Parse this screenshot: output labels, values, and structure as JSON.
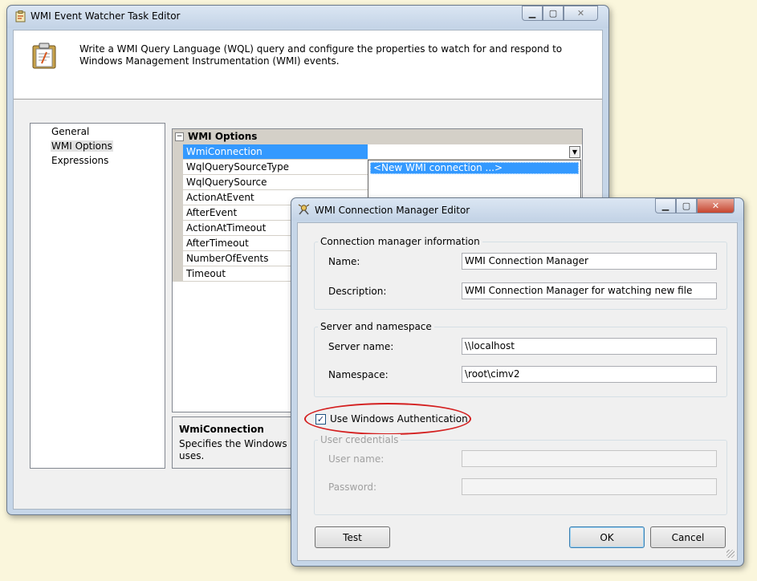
{
  "main_window": {
    "title": "WMI Event Watcher Task Editor",
    "header_text": "Write a WMI Query Language (WQL) query and configure the properties to watch for and respond to Windows Management Instrumentation (WMI) events.",
    "nav_items": [
      "General",
      "WMI Options",
      "Expressions"
    ],
    "grid": {
      "category": "WMI Options",
      "properties": [
        "WmiConnection",
        "WqlQuerySourceType",
        "WqlQuerySource",
        "ActionAtEvent",
        "AfterEvent",
        "ActionAtTimeout",
        "AfterTimeout",
        "NumberOfEvents",
        "Timeout"
      ],
      "dropdown_option": "<New WMI connection ...>"
    },
    "description": {
      "title": "WmiConnection",
      "text_line1": "Specifies the Windows Mar",
      "text_line2": "uses."
    }
  },
  "dialog": {
    "title": "WMI Connection Manager Editor",
    "group_connection": "Connection manager information",
    "name_label": "Name:",
    "name_value": "WMI Connection Manager",
    "description_label": "Description:",
    "description_value": "WMI Connection Manager for watching new file",
    "group_server": "Server and namespace",
    "server_label": "Server name:",
    "server_value": "\\\\localhost",
    "namespace_label": "Namespace:",
    "namespace_value": "\\root\\cimv2",
    "use_windows_auth_label": "Use Windows Authentication",
    "use_windows_auth_checked": true,
    "group_credentials": "User credentials",
    "username_label": "User name:",
    "password_label": "Password:",
    "test_button": "Test",
    "ok_button": "OK",
    "cancel_button": "Cancel"
  },
  "colors": {
    "selection": "#3399ff",
    "highlight_ellipse": "#d42020"
  }
}
